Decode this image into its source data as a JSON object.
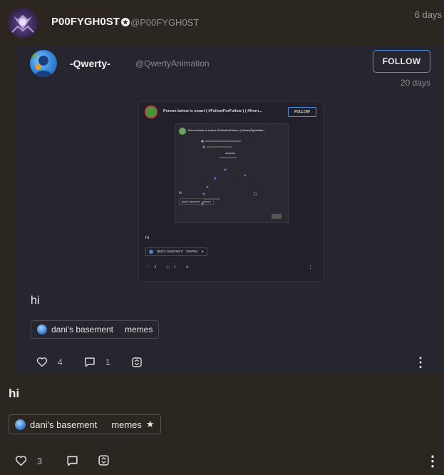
{
  "outer_post": {
    "author_name": "P00FYGH0ST",
    "author_handle": "@P00FYGH0ST",
    "timestamp": "6 days",
    "body_text": "hi",
    "tags": {
      "community": "dani's basement",
      "tag": "memes"
    },
    "actions": {
      "like_count": "3"
    }
  },
  "repost": {
    "author_name": "-Qwerty-",
    "author_handle": "@QwertyAnimation",
    "follow_label": "FOLLOW",
    "timestamp": "20 days",
    "body_text": "hi",
    "tags": {
      "community": "dani's basement",
      "tag": "memes"
    },
    "actions": {
      "like_count": "4",
      "comment_count": "1"
    },
    "nested_image": {
      "title": "Person below is smart ( #FollowForFollow ) ( #Horn...",
      "follow_label": "FOLLOW",
      "inner_title": "Person below is smart ( #FollowForFollow ) ( #HornyFightsHate...",
      "body_text": "hi",
      "community": "dani's basement",
      "tag": "memes",
      "inner_community": "dani's basement",
      "inner_tag": "memes",
      "like_count": "3",
      "comment_count": "1"
    }
  },
  "colors": {
    "background": "#2c2620",
    "card": "#27252d",
    "follow_border": "#4d8fe6"
  }
}
